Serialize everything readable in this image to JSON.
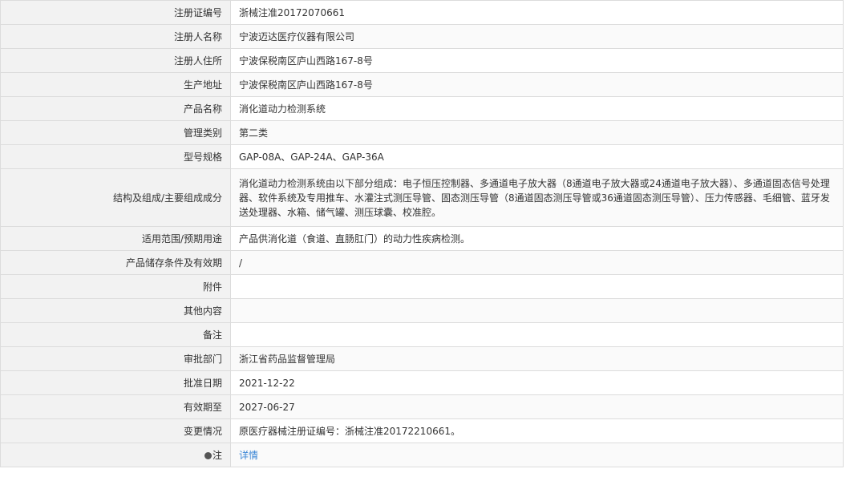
{
  "record": {
    "rows": [
      {
        "label": "注册证编号",
        "value": "浙械注准20172070661"
      },
      {
        "label": "注册人名称",
        "value": "宁波迈达医疗仪器有限公司"
      },
      {
        "label": "注册人住所",
        "value": "宁波保税南区庐山西路167-8号"
      },
      {
        "label": "生产地址",
        "value": "宁波保税南区庐山西路167-8号"
      },
      {
        "label": "产品名称",
        "value": "消化道动力检测系统"
      },
      {
        "label": "管理类别",
        "value": "第二类"
      },
      {
        "label": "型号规格",
        "value": "GAP-08A、GAP-24A、GAP-36A"
      },
      {
        "label": "结构及组成/主要组成成分",
        "value": "消化道动力检测系统由以下部分组成：电子恒压控制器、多通道电子放大器（8通道电子放大器或24通道电子放大器）、多通道固态信号处理器、软件系统及专用推车、水灌注式测压导管、固态测压导管（8通道固态测压导管或36通道固态测压导管）、压力传感器、毛细管、蓝牙发送处理器、水箱、储气罐、测压球囊、校准腔。"
      },
      {
        "label": "适用范围/预期用途",
        "value": "产品供消化道（食道、直肠肛门）的动力性疾病检测。"
      },
      {
        "label": "产品储存条件及有效期",
        "value": "/"
      },
      {
        "label": "附件",
        "value": ""
      },
      {
        "label": "其他内容",
        "value": ""
      },
      {
        "label": "备注",
        "value": ""
      },
      {
        "label": "审批部门",
        "value": "浙江省药品监督管理局"
      },
      {
        "label": "批准日期",
        "value": "2021-12-22"
      },
      {
        "label": "有效期至",
        "value": "2027-06-27"
      },
      {
        "label": "变更情况",
        "value": "原医疗器械注册证编号：浙械注准20172210661。"
      }
    ],
    "note": {
      "label": "注",
      "icon": "bulb-icon",
      "link_text": "详情",
      "link_color": "#3a86d6"
    }
  }
}
